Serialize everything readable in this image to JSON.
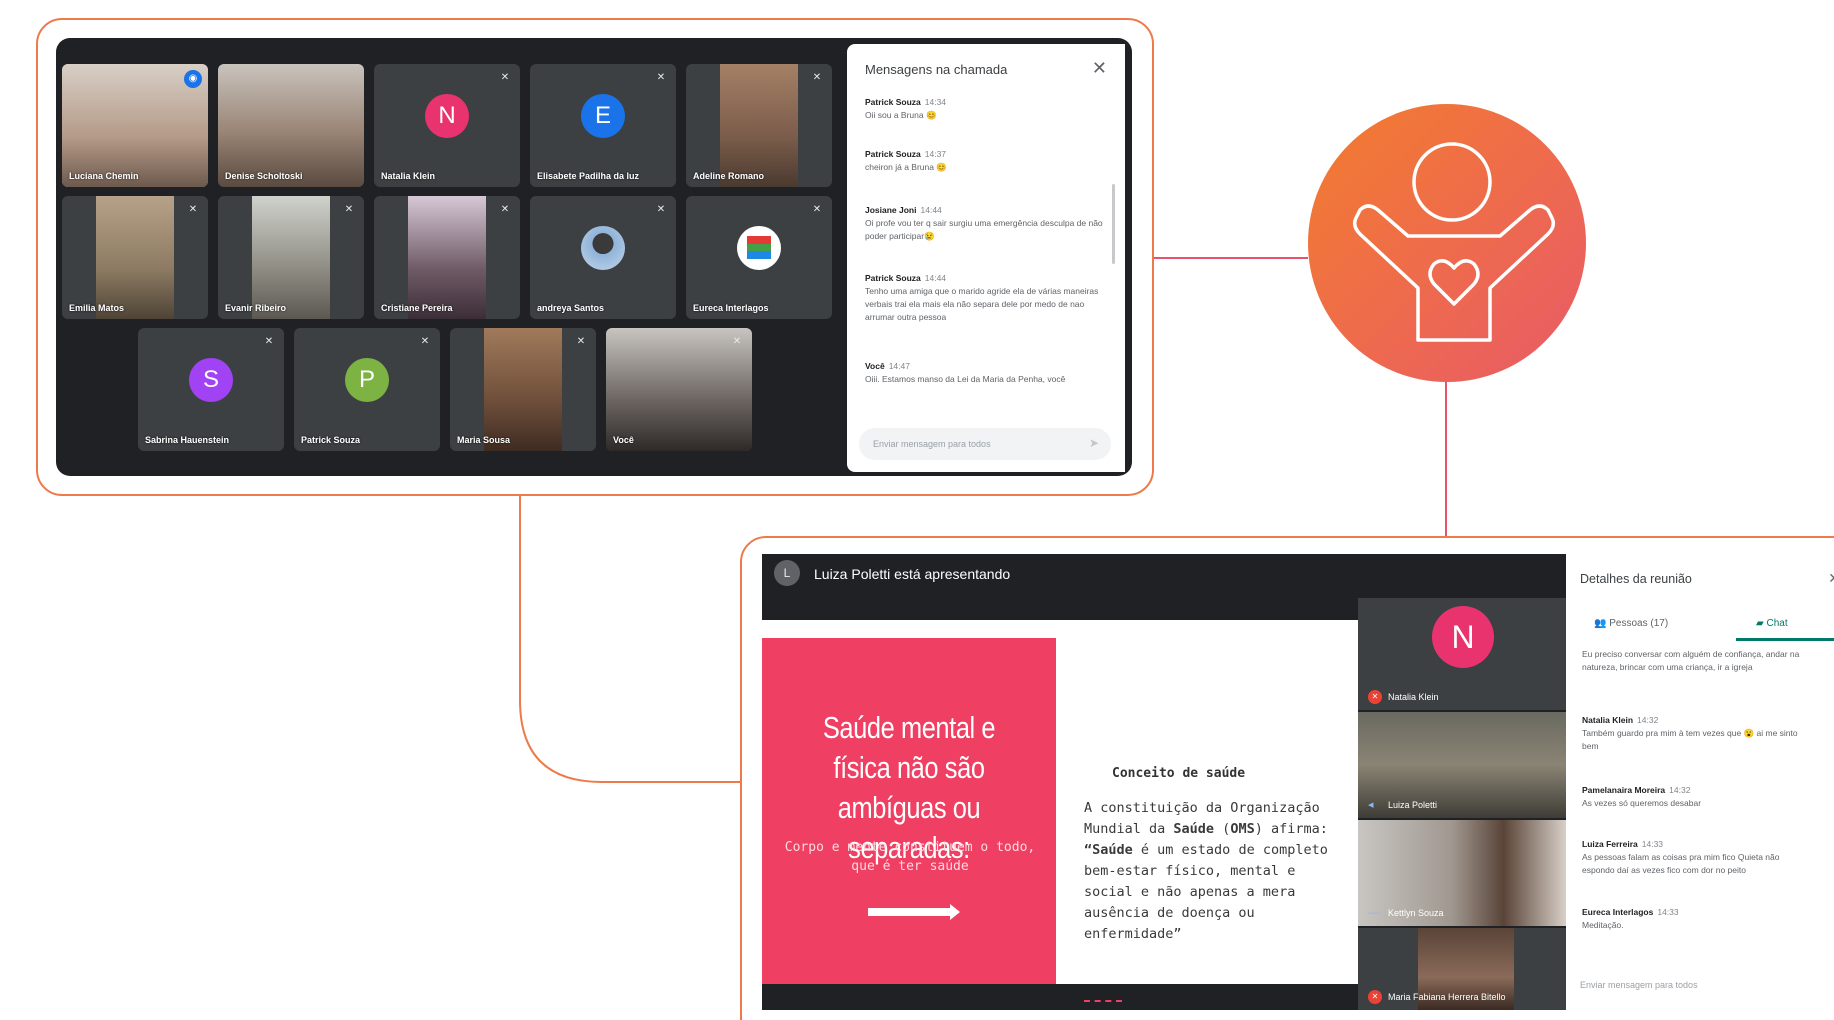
{
  "meet1": {
    "tiles": [
      {
        "name": "Luciana Chemin",
        "bg": "#b49a88"
      },
      {
        "name": "Denise Scholtoski",
        "bg": "#9a8576"
      },
      {
        "name": "Natalia Klein",
        "initial": "N",
        "color": "#e8336f"
      },
      {
        "name": "Elisabete Padilha da luz",
        "initial": "E",
        "color": "#1a73e8"
      },
      {
        "name": "Adeline Romano",
        "bg": "#7a5c4a"
      },
      {
        "name": "Emilia Matos",
        "bg": "#8c7a62"
      },
      {
        "name": "Evanir Ribeiro",
        "bg": "#8e8c82"
      },
      {
        "name": "Cristiane Pereira",
        "bg": "#6e5a66"
      },
      {
        "name": "andreya Santos",
        "avatar": "photo"
      },
      {
        "name": "Eureca Interlagos",
        "avatar": "logo"
      },
      {
        "name": "Sabrina Hauenstein",
        "initial": "S",
        "color": "#a142f4"
      },
      {
        "name": "Patrick Souza",
        "initial": "P",
        "color": "#7cb342"
      },
      {
        "name": "Maria Sousa",
        "bg": "#6e4e3a"
      },
      {
        "name": "Você",
        "bg": "#6a6360"
      }
    ],
    "chat": {
      "title": "Mensagens na chamada",
      "messages": [
        {
          "sender": "Patrick Souza",
          "time": "14:34",
          "text": "Oii sou a Bruna 😊"
        },
        {
          "sender": "Patrick Souza",
          "time": "14:37",
          "text": "cheiron já a Bruna 😊"
        },
        {
          "sender": "Josiane Joni",
          "time": "14:44",
          "text": "Oi profe vou ter q sair surgiu uma emergência desculpa de não poder participar😢"
        },
        {
          "sender": "Patrick Souza",
          "time": "14:44",
          "text": "Tenho uma amiga que o marido agride ela de várias maneiras verbais trai ela mais ela não separa dele por medo de nao arrumar outra pessoa"
        },
        {
          "sender": "Você",
          "time": "14:47",
          "text": "Oiii. Estamos manso da Lei da Maria da Penha, você"
        }
      ],
      "input_placeholder": "Enviar mensagem para todos"
    }
  },
  "meet2": {
    "presenter_initial": "L",
    "presenter_text": "Luiza Poletti está apresentando",
    "slide": {
      "title": "Saúde mental e física não são ambíguas ou separadas:",
      "subtitle": "Corpo e mente constituem o todo, que é ter saúde",
      "heading": "Conceito de saúde",
      "body_before": "A constituição da Organização Mundial da ",
      "body_bold1": "Saúde",
      "body_mid": " (",
      "body_bold2": "OMS",
      "body_after": ") afirma: ",
      "body_bold3": "“Saúde",
      "body_end": " é um estado de completo bem-estar físico, mental e social e não apenas a mera ausência de doença ou enfermidade”"
    },
    "participants": [
      {
        "name": "Natalia Klein",
        "initial": "N"
      },
      {
        "name": "Luiza Poletti"
      },
      {
        "name": "Kettlyn Souza"
      },
      {
        "name": "Maria Fabiana Herrera Bitello"
      }
    ]
  },
  "details": {
    "title": "Detalhes da reunião",
    "tab_people": "Pessoas (17)",
    "tab_chat": "Chat",
    "messages": [
      {
        "sender": "",
        "time": "",
        "text": "Eu preciso conversar com alguém de confiança, andar na natureza, brincar com uma criança, ir a igreja"
      },
      {
        "sender": "Natalia Klein",
        "time": "14:32",
        "text": "Também guardo pra mim à tem vezes que 😮 ai me sinto bem"
      },
      {
        "sender": "Pamelanaira Moreira",
        "time": "14:32",
        "text": "As vezes só queremos desabar"
      },
      {
        "sender": "Luiza Ferreira",
        "time": "14:33",
        "text": "As pessoas falam as coisas pra mim fico Quieta não espondo daí as vezes fico com dor no peito"
      },
      {
        "sender": "Eureca Interlagos",
        "time": "14:33",
        "text": "Meditação."
      }
    ],
    "input_placeholder": "Enviar mensagem para todos"
  },
  "colors": {
    "accent": "#ee7a4a",
    "connector_red": "#e8536a",
    "logo_orange": "#f27c2e",
    "slide_pink": "#ef3f63",
    "meet_dark": "#202124"
  },
  "icons": [
    "child-heart-icon",
    "mic-off-icon",
    "close-icon",
    "send-icon",
    "people-icon",
    "chat-icon"
  ]
}
